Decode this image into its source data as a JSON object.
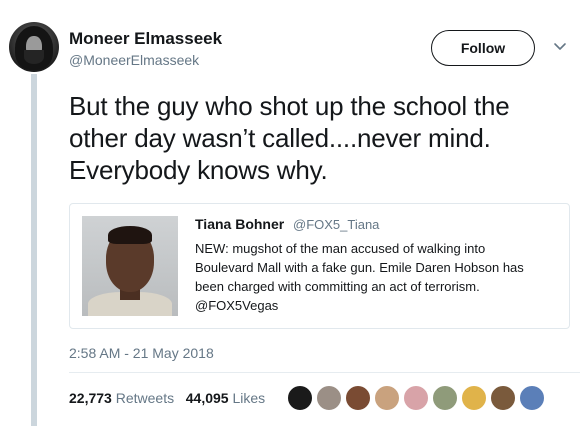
{
  "author": {
    "name": "Moneer Elmasseek",
    "handle": "@MoneerElmasseek"
  },
  "follow_label": "Follow",
  "tweet": {
    "text_lines": [
      "But the guy who shot up the school the",
      "other day wasn’t called....never mind.",
      "Everybody knows why."
    ]
  },
  "quoted": {
    "name": "Tiana Bohner",
    "handle": "@FOX5_Tiana",
    "lines": [
      "NEW: mugshot of the man accused of walking into",
      "Boulevard Mall with a fake gun.  Emile Daren Hobson has",
      "been charged with committing an act of terrorism.",
      "@FOX5Vegas"
    ]
  },
  "timestamp": "2:58 AM - 21 May 2018",
  "stats": {
    "retweets_count": "22,773",
    "retweets_label": "Retweets",
    "likes_count": "44,095",
    "likes_label": "Likes"
  },
  "likers": [
    {
      "color": "#1a1a1a"
    },
    {
      "color": "#9b8f86"
    },
    {
      "color": "#7a4b33"
    },
    {
      "color": "#c9a27e"
    },
    {
      "color": "#d8a3a8"
    },
    {
      "color": "#8f9b7a"
    },
    {
      "color": "#e0b34a"
    },
    {
      "color": "#7a5a3c"
    },
    {
      "color": "#5b7fb8"
    }
  ]
}
